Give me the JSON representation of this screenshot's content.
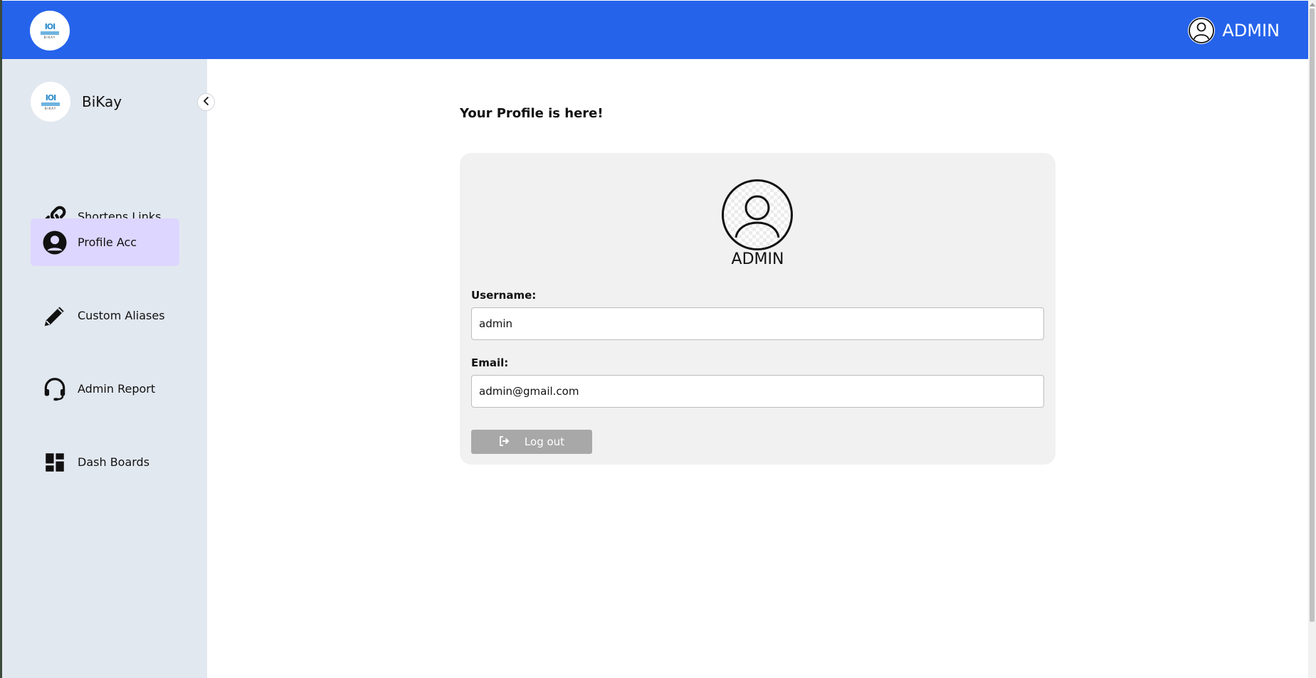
{
  "header": {
    "user_name": "ADMIN",
    "bg_color": "#2563eb"
  },
  "sidebar": {
    "brand_name": "BiKay",
    "bg_color": "#e2e8f0",
    "items": [
      {
        "label": "Shortens Links",
        "icon": "link-icon",
        "active": false
      },
      {
        "label": "Profile Acc",
        "icon": "user-circle-icon",
        "active": true
      },
      {
        "label": "Custom Aliases",
        "icon": "pencil-icon",
        "active": false
      },
      {
        "label": "Admin Report",
        "icon": "headset-icon",
        "active": false
      },
      {
        "label": "Dash Boards",
        "icon": "dashboard-icon",
        "active": false
      }
    ]
  },
  "main": {
    "title": "Your Profile is here!",
    "profile": {
      "display_name": "ADMIN",
      "username_label": "Username:",
      "username_value": "admin",
      "email_label": "Email:",
      "email_value": "admin@gmail.com",
      "logout_label": "Log out"
    }
  }
}
